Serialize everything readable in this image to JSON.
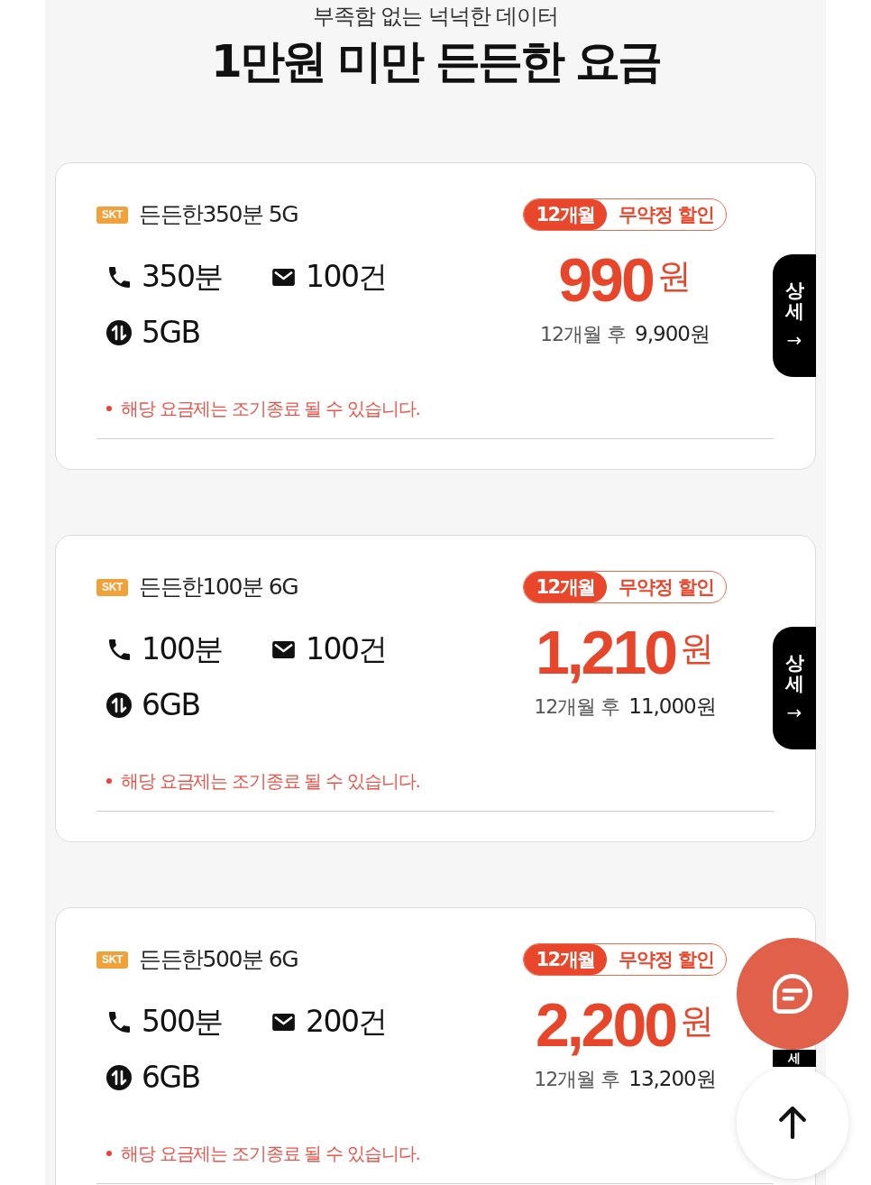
{
  "header": {
    "subtitle": "부족함 없는 넉넉한 데이터",
    "title": "1만원 미만 든든한 요금"
  },
  "plans": [
    {
      "carrier": "SKT",
      "name": "든든한350분 5G",
      "features": [
        {
          "kind": "call",
          "value": "350분"
        },
        {
          "kind": "sms",
          "value": "100건"
        },
        {
          "kind": "data",
          "value": "5GB"
        }
      ],
      "notice": "해당 요금제는 조기종료 될 수 있습니다.",
      "promo": {
        "period": "12개월",
        "label": "무약정 할인"
      },
      "price": {
        "amount": "990",
        "unit": "원"
      },
      "after": {
        "label": "12개월 후",
        "amount": "9,900원"
      },
      "detail_tab": {
        "label": "상세",
        "arrow": "→"
      }
    },
    {
      "carrier": "SKT",
      "name": "든든한100분 6G",
      "features": [
        {
          "kind": "call",
          "value": "100분"
        },
        {
          "kind": "sms",
          "value": "100건"
        },
        {
          "kind": "data",
          "value": "6GB"
        }
      ],
      "notice": "해당 요금제는 조기종료 될 수 있습니다.",
      "promo": {
        "period": "12개월",
        "label": "무약정 할인"
      },
      "price": {
        "amount": "1,210",
        "unit": "원"
      },
      "after": {
        "label": "12개월 후",
        "amount": "11,000원"
      },
      "detail_tab": {
        "label": "상세",
        "arrow": "→"
      }
    },
    {
      "carrier": "SKT",
      "name": "든든한500분 6G",
      "features": [
        {
          "kind": "call",
          "value": "500분"
        },
        {
          "kind": "sms",
          "value": "200건"
        },
        {
          "kind": "data",
          "value": "6GB"
        }
      ],
      "notice": "해당 요금제는 조기종료 될 수 있습니다.",
      "promo": {
        "period": "12개월",
        "label": "무약정 할인"
      },
      "price": {
        "amount": "2,200",
        "unit": "원"
      },
      "after": {
        "label": "12개월 후",
        "amount": "13,200원"
      },
      "detail_tab": {
        "label": "세"
      }
    }
  ],
  "floating_buttons": [
    {
      "kind": "chat"
    },
    {
      "kind": "scroll_top"
    }
  ]
}
